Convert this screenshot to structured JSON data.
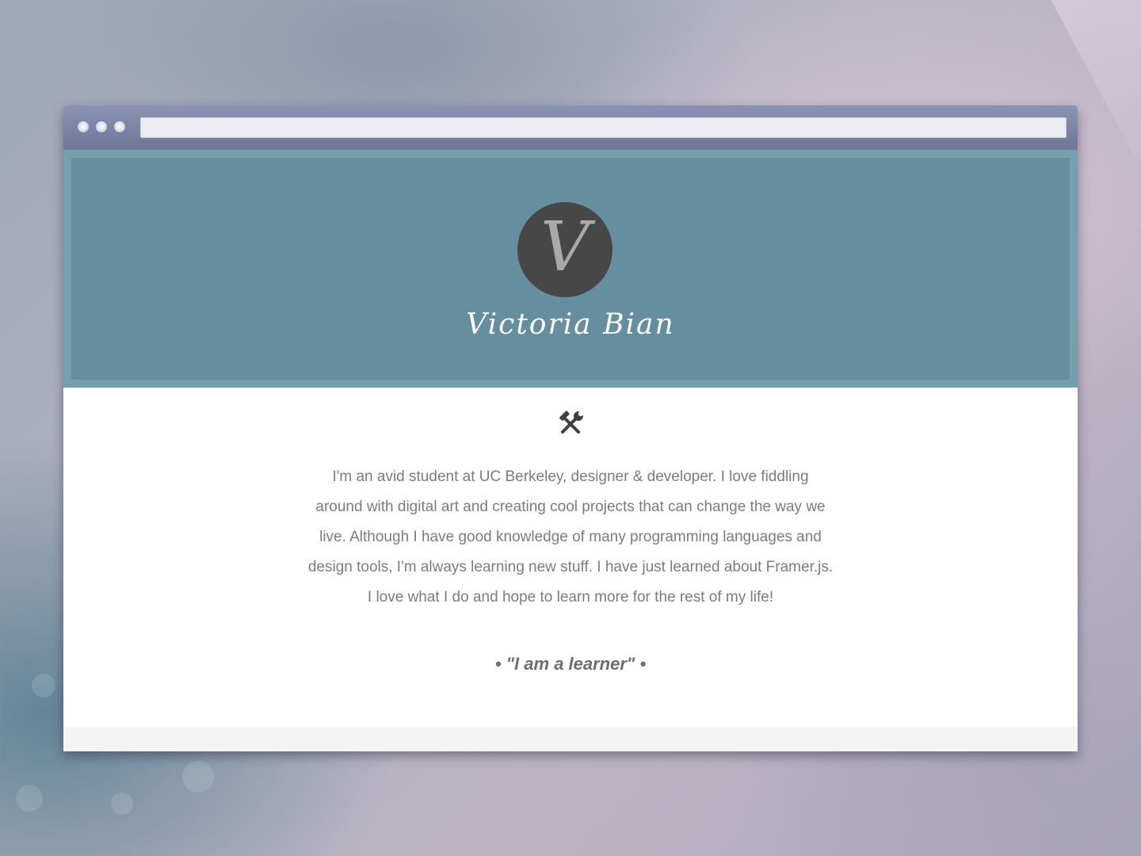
{
  "page": {
    "name": "Victoria Bian",
    "avatar_letter": "V",
    "about_icon": "hammer-and-wrench-icon",
    "bio_lines": [
      "I'm an avid student at UC Berkeley, designer & developer. I love fiddling",
      "around with digital art and creating cool projects that can change the way we",
      "live. Although I have good knowledge of many programming languages and",
      "design tools, I'm always learning new stuff. I have just learned about Framer.js.",
      "I love what I do and hope to learn more for the rest of my life!"
    ],
    "motto": "• \"I am a learner\" •"
  },
  "colors": {
    "toolbar": "#7780a2",
    "hero_frame": "#74a0ae",
    "hero": "#658f9e",
    "avatar": "#474747",
    "body_text": "#7c7c7c"
  }
}
